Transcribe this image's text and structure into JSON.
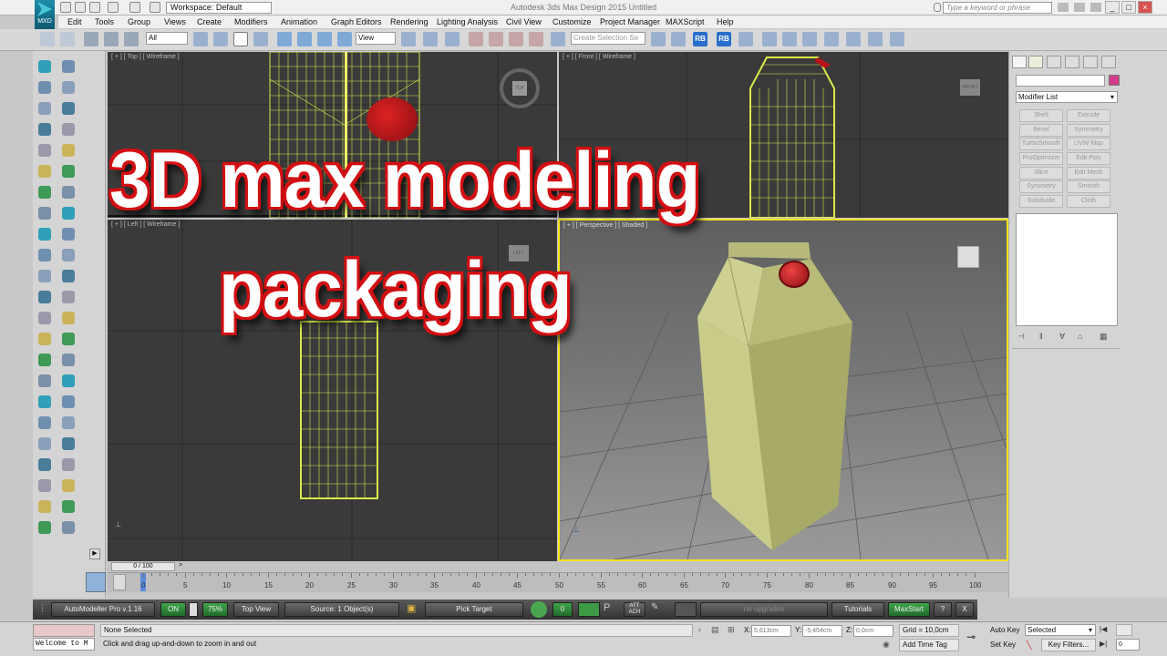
{
  "app": {
    "logo_text": "MXD",
    "workspace_label": "Workspace: Default",
    "title": "Autodesk 3ds Max Design 2015     Untitled",
    "search_placeholder": "Type a keyword or phrase"
  },
  "menu": [
    "Edit",
    "Tools",
    "Group",
    "Views",
    "Create",
    "Modifiers",
    "Animation",
    "Graph Editors",
    "Rendering",
    "Lighting Analysis",
    "Civil View",
    "Customize",
    "Project Manager",
    "MAXScript",
    "Help"
  ],
  "toolbar": {
    "selection_filter": "All",
    "ref_coord": "View",
    "named_selection_placeholder": "Create Selection Se",
    "rb1": "RB",
    "rb2": "RB"
  },
  "viewports": {
    "top": "[ + ] [ Top ] [ Wireframe ]",
    "front": "[ + ] [ Front ] [ Wireframe ]",
    "left": "[ + ] [ Left ] [ Wireframe ]",
    "persp": "[ + ] [ Perspective ] [ Shaded ]",
    "viewcube_top": "TOP",
    "viewcube_front": "FRONT",
    "viewcube_left": "LEFT"
  },
  "caption": {
    "line1": "3D max modeling",
    "line2": "packaging"
  },
  "command_panel": {
    "modifier_list": "Modifier List",
    "buttons": [
      "Shell",
      "Extrude",
      "Bevel",
      "Symmetry",
      "TurboSmooth",
      "UVW Map",
      "ProOptimizer",
      "Edit Poly",
      "Slice",
      "Edit Mesh",
      "Symmetry",
      "Smooth",
      "Subdivide",
      "Cloth"
    ],
    "color_swatch": "#d23b8c"
  },
  "timeline": {
    "frame_display": "0 / 100",
    "ticks": [
      "0",
      "5",
      "10",
      "15",
      "20",
      "25",
      "30",
      "35",
      "40",
      "45",
      "50",
      "55",
      "60",
      "65",
      "70",
      "75",
      "80",
      "85",
      "90",
      "95",
      "100"
    ]
  },
  "automodeller": {
    "title": "AutoModeller Pro v.1.16",
    "on": "ON",
    "percent": "75%",
    "view": "Top View",
    "source": "Source: 1 Object(s)",
    "pick_target": "Pick Target",
    "count": "0",
    "attach": "ATT ACH",
    "upgrades": "no upgrades",
    "tutorials": "Tutorials",
    "maxstart": "MaxStart",
    "help": "?",
    "close": "X"
  },
  "status": {
    "maxscript_listener": "Welcome to M",
    "selection": "None Selected",
    "prompt": "Click and drag up-and-down to zoom in and out",
    "x_label": "X:",
    "x_value": "5,613cm",
    "y_label": "Y:",
    "y_value": "-5,454cm",
    "z_label": "Z:",
    "z_value": "0,0cm",
    "grid": "Grid = 10,0cm",
    "add_time_tag": "Add Time Tag",
    "auto_key": "Auto Key",
    "set_key": "Set Key",
    "key_mode": "Selected",
    "key_filters": "Key Filters...",
    "frame": "0"
  },
  "colors": {
    "wire": "#d9e84a",
    "cap": "#b8141c",
    "carton": "#c9cb8a",
    "active_border": "#f4e31e",
    "caption_outline": "#d20f12"
  }
}
